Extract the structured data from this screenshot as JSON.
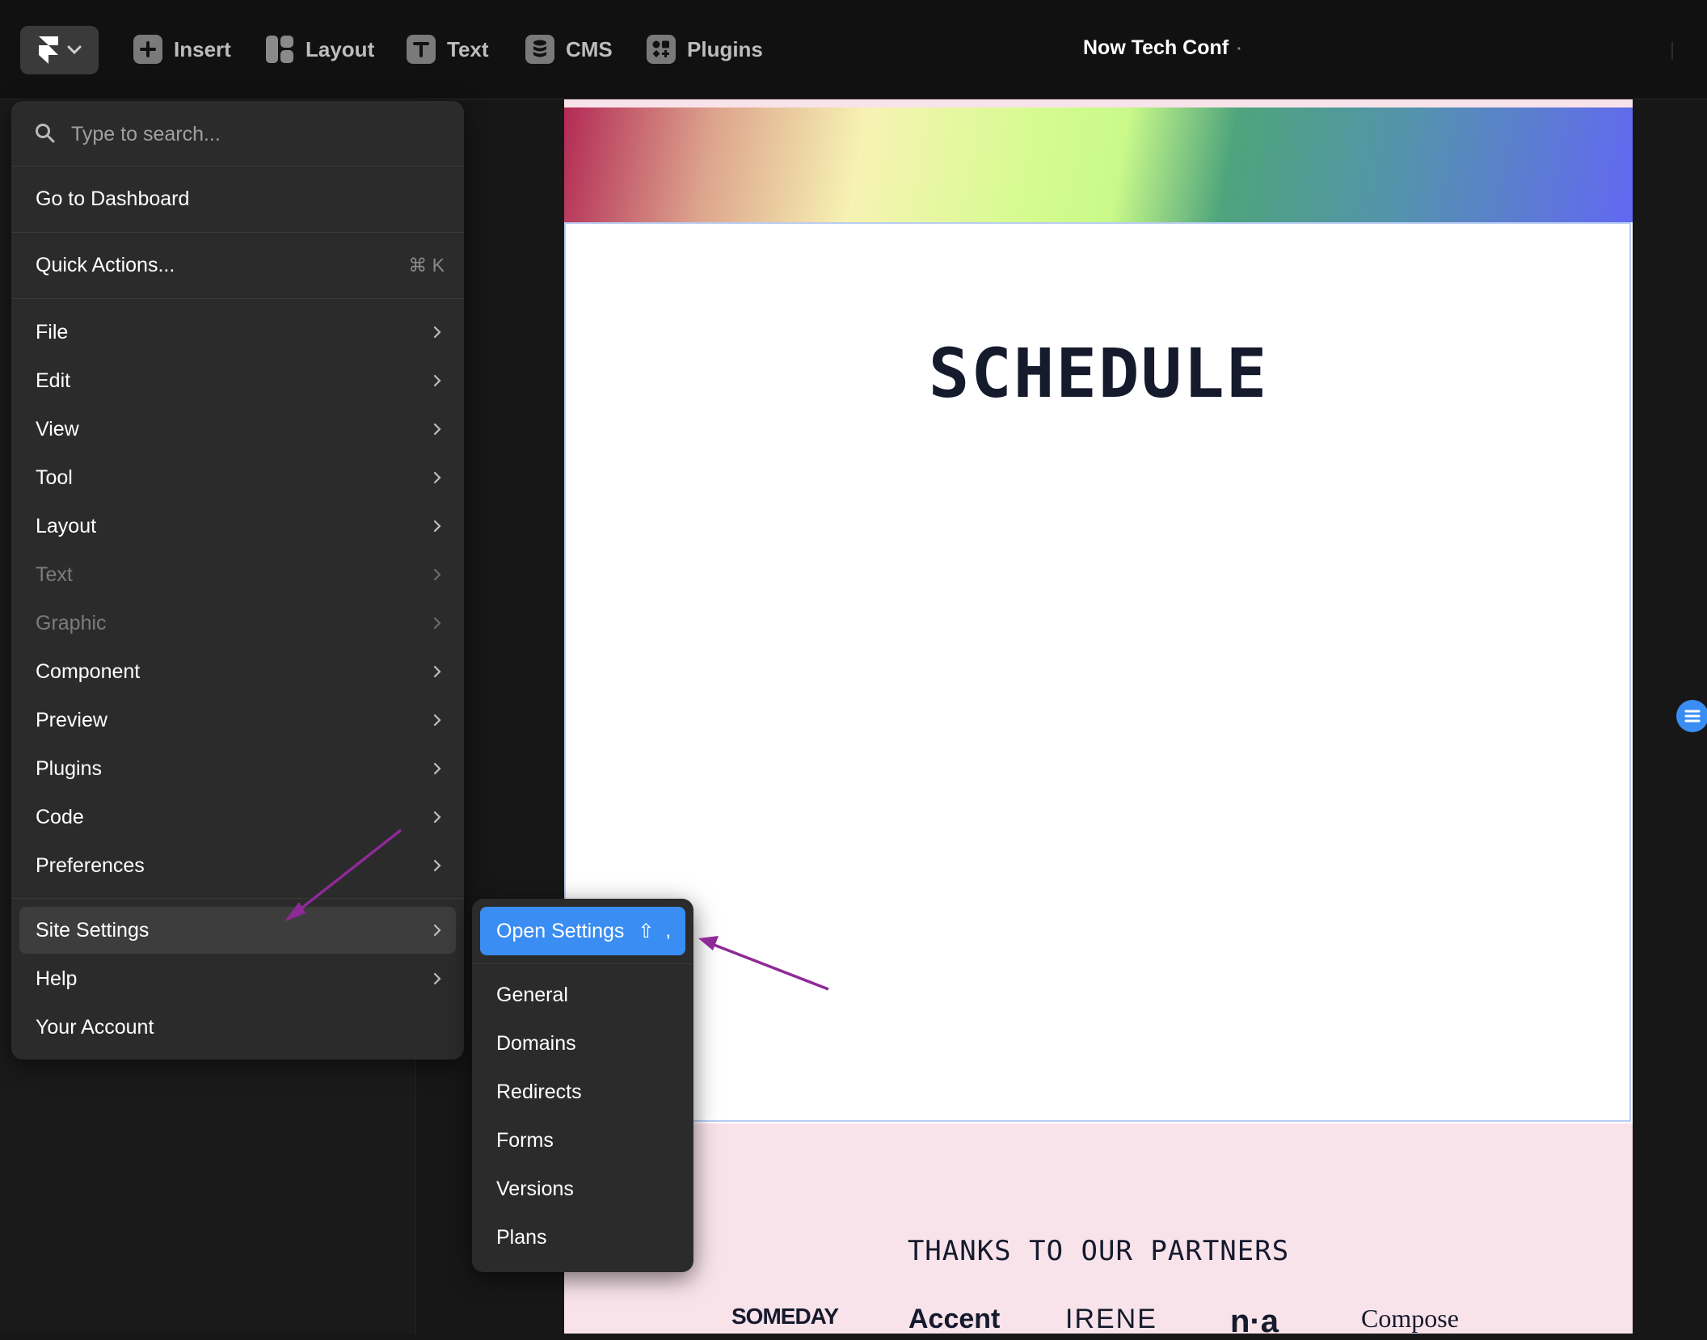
{
  "toolbar": {
    "items": [
      {
        "label": "Insert",
        "icon": "plus-icon"
      },
      {
        "label": "Layout",
        "icon": "layout-icon"
      },
      {
        "label": "Text",
        "icon": "text-icon"
      },
      {
        "label": "CMS",
        "icon": "database-icon"
      },
      {
        "label": "Plugins",
        "icon": "plugins-icon"
      }
    ],
    "title": "Now Tech Conf",
    "title_suffix": "·"
  },
  "menu": {
    "search_placeholder": "Type to search...",
    "dashboard": "Go to Dashboard",
    "quick_actions": "Quick Actions...",
    "quick_actions_shortcut": "⌘ K",
    "items": [
      {
        "label": "File",
        "disabled": false
      },
      {
        "label": "Edit",
        "disabled": false
      },
      {
        "label": "View",
        "disabled": false
      },
      {
        "label": "Tool",
        "disabled": false
      },
      {
        "label": "Layout",
        "disabled": false
      },
      {
        "label": "Text",
        "disabled": true
      },
      {
        "label": "Graphic",
        "disabled": true
      },
      {
        "label": "Component",
        "disabled": false
      },
      {
        "label": "Preview",
        "disabled": false
      },
      {
        "label": "Plugins",
        "disabled": false
      },
      {
        "label": "Code",
        "disabled": false
      },
      {
        "label": "Preferences",
        "disabled": false
      }
    ],
    "site_settings": "Site Settings",
    "help": "Help",
    "your_account": "Your Account"
  },
  "submenu": {
    "open_settings": "Open Settings",
    "open_settings_key1": "⇧",
    "open_settings_key2": ",",
    "items": [
      "General",
      "Domains",
      "Redirects",
      "Forms",
      "Versions",
      "Plans"
    ]
  },
  "canvas": {
    "schedule_title": "SCHEDULE",
    "partners_title": "THANKS TO OUR PARTNERS",
    "partners": [
      "SOMEDAY",
      "Accent",
      "IRENE",
      "n·a",
      "Compose"
    ]
  },
  "colors": {
    "accent": "#3a8df2",
    "menu_bg": "#2b2b2b",
    "toolbar_bg": "#111111",
    "annotation_arrow": "#8e2a97",
    "partners_bg": "#f9e3ea"
  }
}
